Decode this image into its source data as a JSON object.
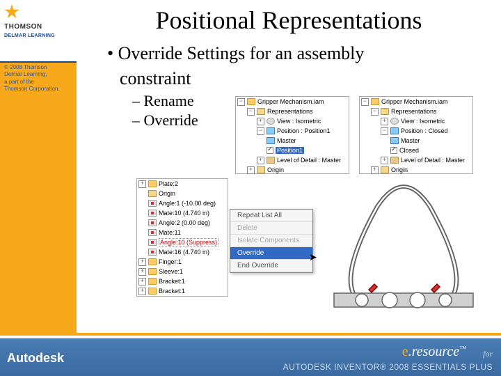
{
  "sidebar": {
    "brand_word": "THOMSON",
    "brand_sub": "DELMAR LEARNING",
    "copyright_l1": "© 2008 Thomson",
    "copyright_l2": "Delmar Learning,",
    "copyright_l3": "a part of the",
    "copyright_l4": "Thomson Corporation."
  },
  "slide": {
    "title": "Positional Representations",
    "bullet1": "• Override Settings for an assembly",
    "bullet1b": "constraint",
    "dash1": "– Rename",
    "dash2": "– Override"
  },
  "tree_left": {
    "root": "Gripper Mechanism.iam",
    "reps": "Representations",
    "view": "View : Isometric",
    "pos": "Position : Position1",
    "master": "Master",
    "position1": "Position1",
    "lod": "Level of Detail : Master",
    "origin": "Origin"
  },
  "tree_right": {
    "root": "Gripper Mechanism.iam",
    "reps": "Representations",
    "view": "View : Isometric",
    "pos": "Position : Closed",
    "master": "Master",
    "closed": "Closed",
    "lod": "Level of Detail : Master",
    "origin": "Origin"
  },
  "tree_big": {
    "r0": "Plate:2",
    "r1": "Origin",
    "r2": "Angle:1 (-10.00 deg)",
    "r3": "Mate:10 (4.740 in)",
    "r4": "Angle:2 (0.00 deg)",
    "r5": "Mate:11",
    "r6": "Angle:10 (Suppress)",
    "r7": "Mate:16 (4.740 in)",
    "r8": "Finger:1",
    "r9": "Sleeve:1",
    "r10": "Bracket:1",
    "r11": "Bracket:1"
  },
  "menu": {
    "m0": "Repeat List All",
    "m1": "Delete",
    "m2": "Isolate Components",
    "m3": "Override",
    "m4": "End Override"
  },
  "footer": {
    "autodesk": "Autodesk",
    "eresource": "e.resource",
    "for": "for",
    "inventor": "AUTODESK INVENTOR® 2008 ESSENTIALS PLUS"
  }
}
